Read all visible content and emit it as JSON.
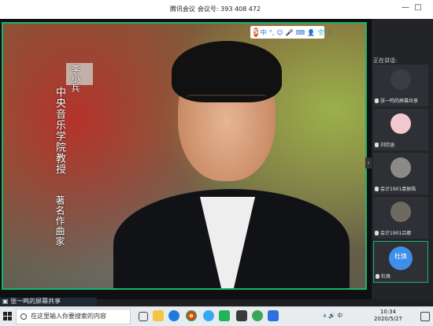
{
  "window": {
    "title_app": "腾讯会议",
    "title_id": "会议号: 393 408 472",
    "controls": {
      "minimize": "—",
      "maximize": "□"
    }
  },
  "share": {
    "caption_name": "李小兵",
    "caption_line1": "中央音乐学院教授",
    "caption_line2": "著名作曲家",
    "sharing_label": "张一鸣的屏幕共享",
    "toolbar": {
      "logo": "S",
      "items": [
        "中",
        "°,",
        "☺",
        "🎤",
        "⌨",
        "👤",
        "👕",
        "⁝⁝"
      ]
    }
  },
  "sidebar": {
    "speaking_label": "正在讲话:",
    "tiles": [
      {
        "label": "张一鸣的屏幕共享",
        "avatar_color": "#3b3d42"
      },
      {
        "label": "刘欣涵",
        "avatar_color": "#f2c9cf"
      },
      {
        "label": "会计1901袁振皓",
        "avatar_color": "#8c8a86"
      },
      {
        "label": "会计1901吕娜",
        "avatar_color": "#6e6a62"
      },
      {
        "label": "杜焕",
        "avatar_text": "杜焕",
        "avatar_color": "#3e8fe8"
      }
    ]
  },
  "taskbar": {
    "search_placeholder": "在这里输入你要搜索的内容",
    "time": "10:34",
    "date": "2020/5/27",
    "tray_text": "∧ 🔊 中"
  },
  "colors": {
    "active_border": "#1bb26a",
    "accent_blue": "#3e8fe8"
  }
}
